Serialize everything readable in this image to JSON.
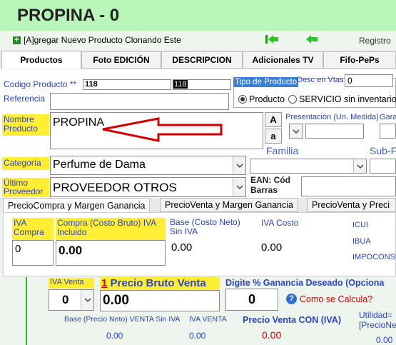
{
  "title": "PROPINA - 0",
  "toolbar": {
    "add_clone": "[A]gregar Nuevo Producto Clonando Este",
    "registro": "Registro"
  },
  "tabs": [
    "Productos",
    "Foto EDICIÓN",
    "DESCRIPCION",
    "Adicionales TV",
    "Fifo-PePs"
  ],
  "form": {
    "codigo_label": "Codigo Producto **",
    "codigo_value": "118",
    "codigo_value2": "118",
    "referencia_label": "Referencia",
    "tipo_label": "Tipo de Producto",
    "tipo_producto": "Producto",
    "tipo_servicio": "SERVICIO sin inventario",
    "desc_label": "Desc en Vtas",
    "desc_value": "0",
    "nombre_label": "Nombre Producto",
    "nombre_value": "PROPINA",
    "btn_A": "A",
    "btn_a": "a",
    "presentacion_label": "Presentación (Un. Medida)",
    "garantia_label": "Gara",
    "categoria_label": "Categoría",
    "categoria_value": "Perfume de Dama",
    "familia_label": "Familia",
    "subfamilia_label": "Sub-F",
    "proveedor_label": "Último Proveedor",
    "proveedor_value": "PROVEEDOR OTROS",
    "ean_label": "EAN: Cód Barras"
  },
  "subtabs": [
    "PrecioCompra y Margen Ganancia",
    "PrecioVenta y Margen Ganancia",
    "PrecioVenta y Preci"
  ],
  "compra": {
    "iva_compra_label": "IVA Compra",
    "iva_compra_value": "0",
    "costo_bruto_label": "Compra (Costo Bruto) IVA Incluido",
    "costo_bruto_value": "0.00",
    "base_label": "Base (Costo Neto) Sin IVA",
    "base_value": "0.00",
    "iva_costo_label": "IVA Costo",
    "iva_costo_value": "0.00",
    "icui": "ICUI",
    "ibua": "IBUA",
    "impoconsumo": "IMPOCONSU"
  },
  "venta": {
    "iva_venta_label": "IVA Venta",
    "iva_venta_value": "0",
    "precio_bruto_num": "1",
    "precio_bruto_label": " Precio Bruto Venta",
    "precio_bruto_value": "0.00",
    "ganancia_label": "Digite % Ganancia Deseado (Opciona",
    "ganancia_value": "0",
    "como_calcula": "Como se Calcula?",
    "help_icon_text": "?",
    "base_venta_label": "Base (Precio Neto) VENTA Sin IVA",
    "base_venta_value": "0.00",
    "iva_venta2_label": "IVA VENTA",
    "iva_venta2_value": "0.00",
    "precio_con_iva_label": "Precio Venta CON (IVA)",
    "precio_con_iva_value": "0.00",
    "utilidad_label": "Utilidad=",
    "utilidad_label2": "[PrecioNe",
    "utilidad_value": "0.00"
  },
  "colors": {
    "accent_blue": "#2a45c8",
    "highlight": "#ffee33",
    "title_bg": "#b9f7b8",
    "red": "#d40000"
  }
}
